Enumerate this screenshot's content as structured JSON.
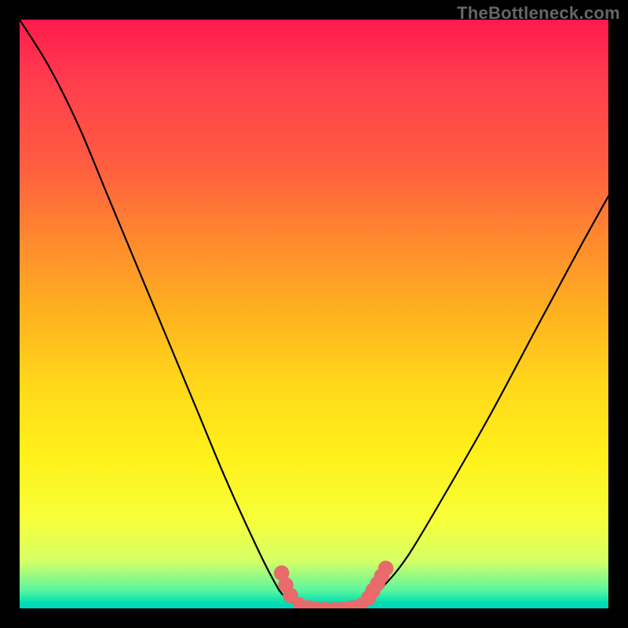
{
  "watermark": {
    "text": "TheBottleneck.com"
  },
  "chart_data": {
    "type": "line",
    "title": "",
    "xlabel": "",
    "ylabel": "",
    "xlim": [
      0,
      100
    ],
    "ylim": [
      0,
      100
    ],
    "curve": {
      "name": "bottleneck-curve",
      "points": [
        {
          "x": 0,
          "y": 100
        },
        {
          "x": 5,
          "y": 92
        },
        {
          "x": 10,
          "y": 82
        },
        {
          "x": 15,
          "y": 70
        },
        {
          "x": 20,
          "y": 58
        },
        {
          "x": 25,
          "y": 46
        },
        {
          "x": 30,
          "y": 34
        },
        {
          "x": 35,
          "y": 22
        },
        {
          "x": 40,
          "y": 11
        },
        {
          "x": 43,
          "y": 5
        },
        {
          "x": 45,
          "y": 2
        },
        {
          "x": 48,
          "y": 0.4
        },
        {
          "x": 52,
          "y": 0
        },
        {
          "x": 56,
          "y": 0.2
        },
        {
          "x": 59,
          "y": 1.5
        },
        {
          "x": 62,
          "y": 4
        },
        {
          "x": 66,
          "y": 9
        },
        {
          "x": 72,
          "y": 19
        },
        {
          "x": 80,
          "y": 33
        },
        {
          "x": 88,
          "y": 48
        },
        {
          "x": 95,
          "y": 61
        },
        {
          "x": 100,
          "y": 70
        }
      ]
    },
    "markers": [
      {
        "x": 44.5,
        "y": 6.0,
        "r": 1.3
      },
      {
        "x": 45.2,
        "y": 4.0,
        "r": 1.3
      },
      {
        "x": 46.0,
        "y": 2.2,
        "r": 1.3
      },
      {
        "x": 47.5,
        "y": 0.8,
        "r": 1.1
      },
      {
        "x": 49.0,
        "y": 0.3,
        "r": 1.1
      },
      {
        "x": 50.5,
        "y": 0.1,
        "r": 1.1
      },
      {
        "x": 52.0,
        "y": 0.0,
        "r": 1.1
      },
      {
        "x": 53.5,
        "y": 0.0,
        "r": 1.1
      },
      {
        "x": 55.0,
        "y": 0.1,
        "r": 1.1
      },
      {
        "x": 56.5,
        "y": 0.3,
        "r": 1.1
      },
      {
        "x": 58.0,
        "y": 0.7,
        "r": 1.1
      },
      {
        "x": 59.3,
        "y": 1.8,
        "r": 1.3
      },
      {
        "x": 60.0,
        "y": 3.0,
        "r": 1.3
      },
      {
        "x": 60.8,
        "y": 4.2,
        "r": 1.3
      },
      {
        "x": 61.5,
        "y": 5.5,
        "r": 1.3
      },
      {
        "x": 62.2,
        "y": 6.8,
        "r": 1.3
      }
    ],
    "colors": {
      "curve_stroke": "#000000",
      "marker_fill": "#e86a6a",
      "gradient_top": "#ff1a4d",
      "gradient_mid": "#ffd81a",
      "gradient_bottom": "#00d3c0"
    }
  }
}
